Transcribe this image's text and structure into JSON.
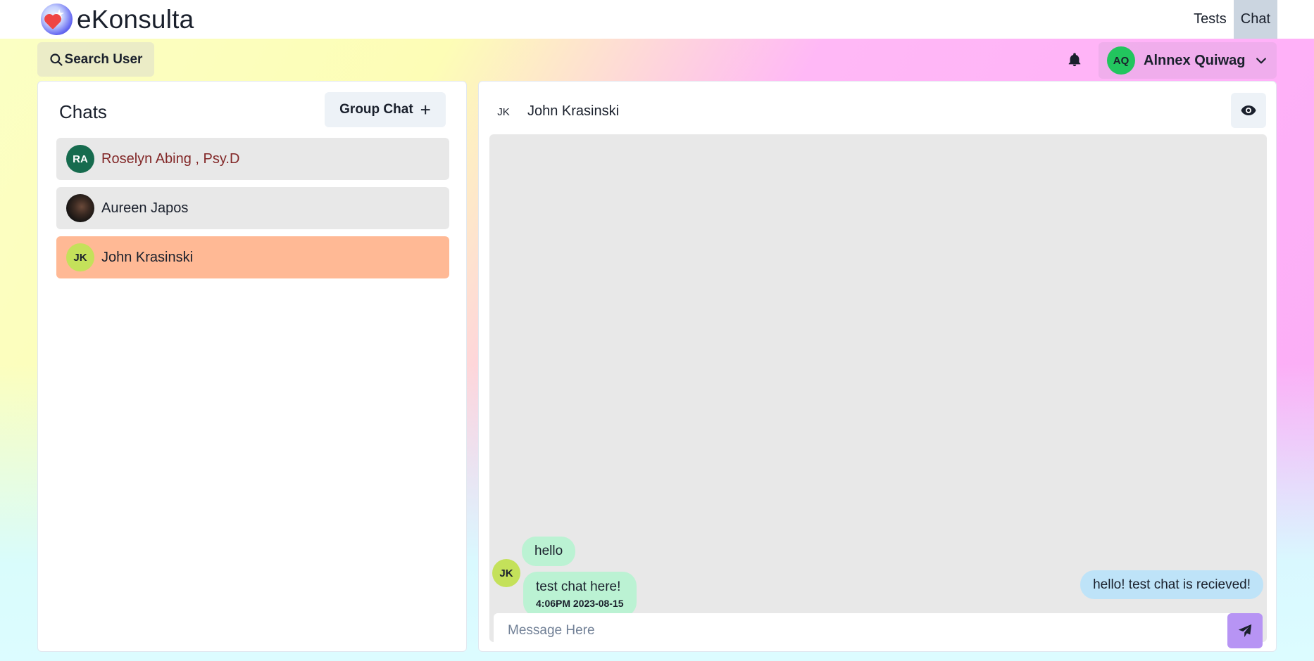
{
  "app": {
    "brand": "eKonsulta"
  },
  "nav": {
    "tests": "Tests",
    "chat": "Chat"
  },
  "toolbar": {
    "search_label": "Search User"
  },
  "user": {
    "initials": "AQ",
    "name": "Alnnex Quiwag"
  },
  "chats": {
    "title": "Chats",
    "group_chat_label": "Group Chat",
    "items": [
      {
        "initials": "RA",
        "name": "Roselyn Abing , Psy.D",
        "name_color": "#822727"
      },
      {
        "initials": "",
        "name": "Aureen Japos"
      },
      {
        "initials": "JK",
        "name": "John Krasinski"
      }
    ]
  },
  "conversation": {
    "initials": "JK",
    "name": "John Krasinski",
    "messages": [
      {
        "text": "hello",
        "from": "other"
      },
      {
        "text": "test chat here!",
        "time": "4:06PM 2023-08-15",
        "from": "other",
        "avatar": "JK"
      },
      {
        "text": "hello! test chat is recieved!",
        "from": "me"
      }
    ],
    "input_placeholder": "Message Here",
    "input_value": ""
  },
  "colors": {
    "selected_chat": "#ffb995",
    "incoming_bubble": "#bbf2d3",
    "outgoing_bubble": "#bee3f8",
    "send_button": "#b794f4",
    "user_avatar": "#22c55e"
  }
}
